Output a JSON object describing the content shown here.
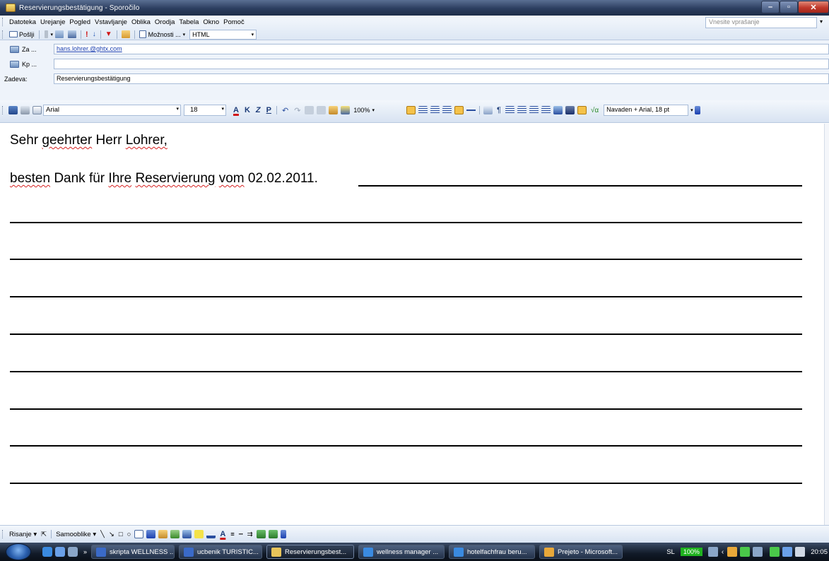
{
  "window": {
    "title": "Reservierungsbestätigung - Sporočilo",
    "minimize": "–",
    "maximize": "▫",
    "close": "✕"
  },
  "menu": {
    "items": [
      "Datoteka",
      "Urejanje",
      "Pogled",
      "Vstavljanje",
      "Oblika",
      "Orodja",
      "Tabela",
      "Okno",
      "Pomoč"
    ],
    "ask_placeholder": "Vnesite vprašanje"
  },
  "toolbar": {
    "send_label": "Pošlji",
    "options_label": "Možnosti ...",
    "format_value": "HTML"
  },
  "fields": {
    "to_label": "Za ...",
    "to_value": "hans.lohrer.@ghtx.com",
    "cc_label": "Kp ...",
    "cc_value": "",
    "subject_label": "Zadeva:",
    "subject_value": "Reservierungsbestätigung"
  },
  "format_bar": {
    "font": "Arial",
    "size": "18",
    "bold": "K",
    "italic": "Z",
    "underline": "P",
    "zoom": "100%",
    "style": "Navaden + Arial, 18 pt"
  },
  "document": {
    "greeting_part1": "Sehr",
    "greeting_part2": "geehrter",
    "greeting_part3": "Herr",
    "greeting_part4": "Lohrer,",
    "line2_part1": "besten",
    "line2_part2": "Dank für",
    "line2_part3": "Ihre",
    "line2_part4": "Reservierung",
    "line2_part5": "vom",
    "line2_part6": "02.02.2011."
  },
  "drawing_bar": {
    "draw_label": "Risanje",
    "autoshapes_label": "Samooblike"
  },
  "taskbar": {
    "tasks": [
      "skripta WELLNESS ...",
      "ucbenik TURISTIC...",
      "Reservierungsbest...",
      "wellness manager ...",
      "hotelfachfrau beru...",
      "Prejeto - Microsoft..."
    ],
    "language": "SL",
    "battery": "100%",
    "time": "20:05"
  },
  "colors": {
    "title_bar": "#2c3e5f",
    "toolbar_bg": "#dde7f4",
    "link": "#1a3fb0",
    "spellcheck": "#d62020",
    "taskbar": "#111a28"
  }
}
